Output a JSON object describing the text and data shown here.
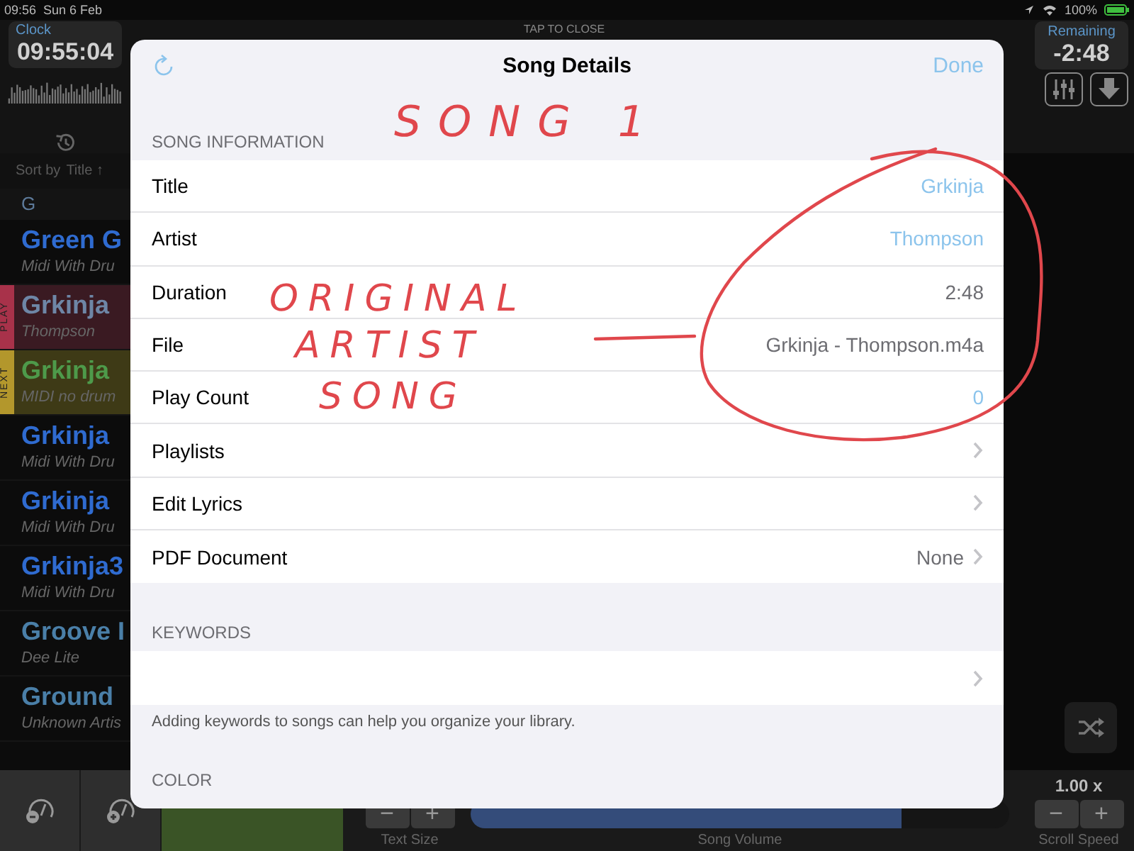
{
  "status_bar": {
    "time": "09:56",
    "date": "Sun 6 Feb",
    "battery": "100%"
  },
  "header": {
    "clock_label": "Clock",
    "clock": "09:55:04",
    "hint": "TAP TO CLOSE",
    "remaining_label": "Remaining",
    "remaining": "-2:48"
  },
  "library": {
    "sort_label": "Sort by",
    "sort_value": "Title ↑",
    "section": "G",
    "songs": [
      {
        "title": "Green G",
        "subtitle": "Midi With Dru",
        "kind": "normal",
        "color": "#2f6bd0"
      },
      {
        "title": "Grkinja",
        "subtitle": "Thompson",
        "kind": "play",
        "badge": "PLAY",
        "color": "#6e86a6"
      },
      {
        "title": "Grkinja",
        "subtitle": "MIDI no drum",
        "kind": "next",
        "badge": "NEXT",
        "color": "#4e9a4a"
      },
      {
        "title": "Grkinja",
        "subtitle": "Midi With Dru",
        "kind": "normal",
        "color": "#2f6bd0"
      },
      {
        "title": "Grkinja",
        "subtitle": "Midi With Dru",
        "kind": "normal",
        "color": "#2f6bd0"
      },
      {
        "title": "Grkinja3",
        "subtitle": "Midi With Dru",
        "kind": "normal",
        "color": "#2f6bd0"
      },
      {
        "title": "Groove I",
        "subtitle": "Dee Lite",
        "kind": "normal",
        "color": "#4a7fa8"
      },
      {
        "title": "Ground",
        "subtitle": "Unknown Artis",
        "kind": "normal",
        "color": "#4a7fa8"
      }
    ]
  },
  "modal": {
    "title": "Song Details",
    "done": "Done",
    "sections": [
      {
        "header": "SONG INFORMATION",
        "rows": [
          {
            "kind": "editable",
            "label": "Title",
            "value": "Grkinja"
          },
          {
            "kind": "editable",
            "label": "Artist",
            "value": "Thompson"
          },
          {
            "kind": "plain",
            "label": "Duration",
            "value": "2:48"
          },
          {
            "kind": "plain",
            "label": "File",
            "value": "Grkinja - Thompson.m4a"
          },
          {
            "kind": "editable",
            "label": "Play Count",
            "value": "0"
          },
          {
            "kind": "disclosure",
            "label": "Playlists"
          },
          {
            "kind": "disclosure",
            "label": "Edit Lyrics"
          },
          {
            "kind": "disclosure",
            "label": "PDF Document",
            "value": "None"
          }
        ]
      },
      {
        "header": "KEYWORDS",
        "rows": [
          {
            "kind": "disclosure"
          }
        ],
        "footer": "Adding keywords to songs can help you organize your library."
      },
      {
        "header": "COLOR"
      }
    ]
  },
  "bottom_bar": {
    "text_size_buttons": [
      "−",
      "+"
    ],
    "text_size_label": "Text Size",
    "volume": {
      "level": 0.8
    },
    "volume_label": "Song Volume",
    "scroll_speed": "1.00 x",
    "scroll_buttons": [
      "−",
      "+"
    ],
    "scroll_label": "Scroll Speed"
  },
  "annotations": [
    {
      "text": "SONG 1"
    },
    {
      "text": "ORIGINAL"
    },
    {
      "text": "ARTIST"
    },
    {
      "text": "SONG"
    }
  ]
}
